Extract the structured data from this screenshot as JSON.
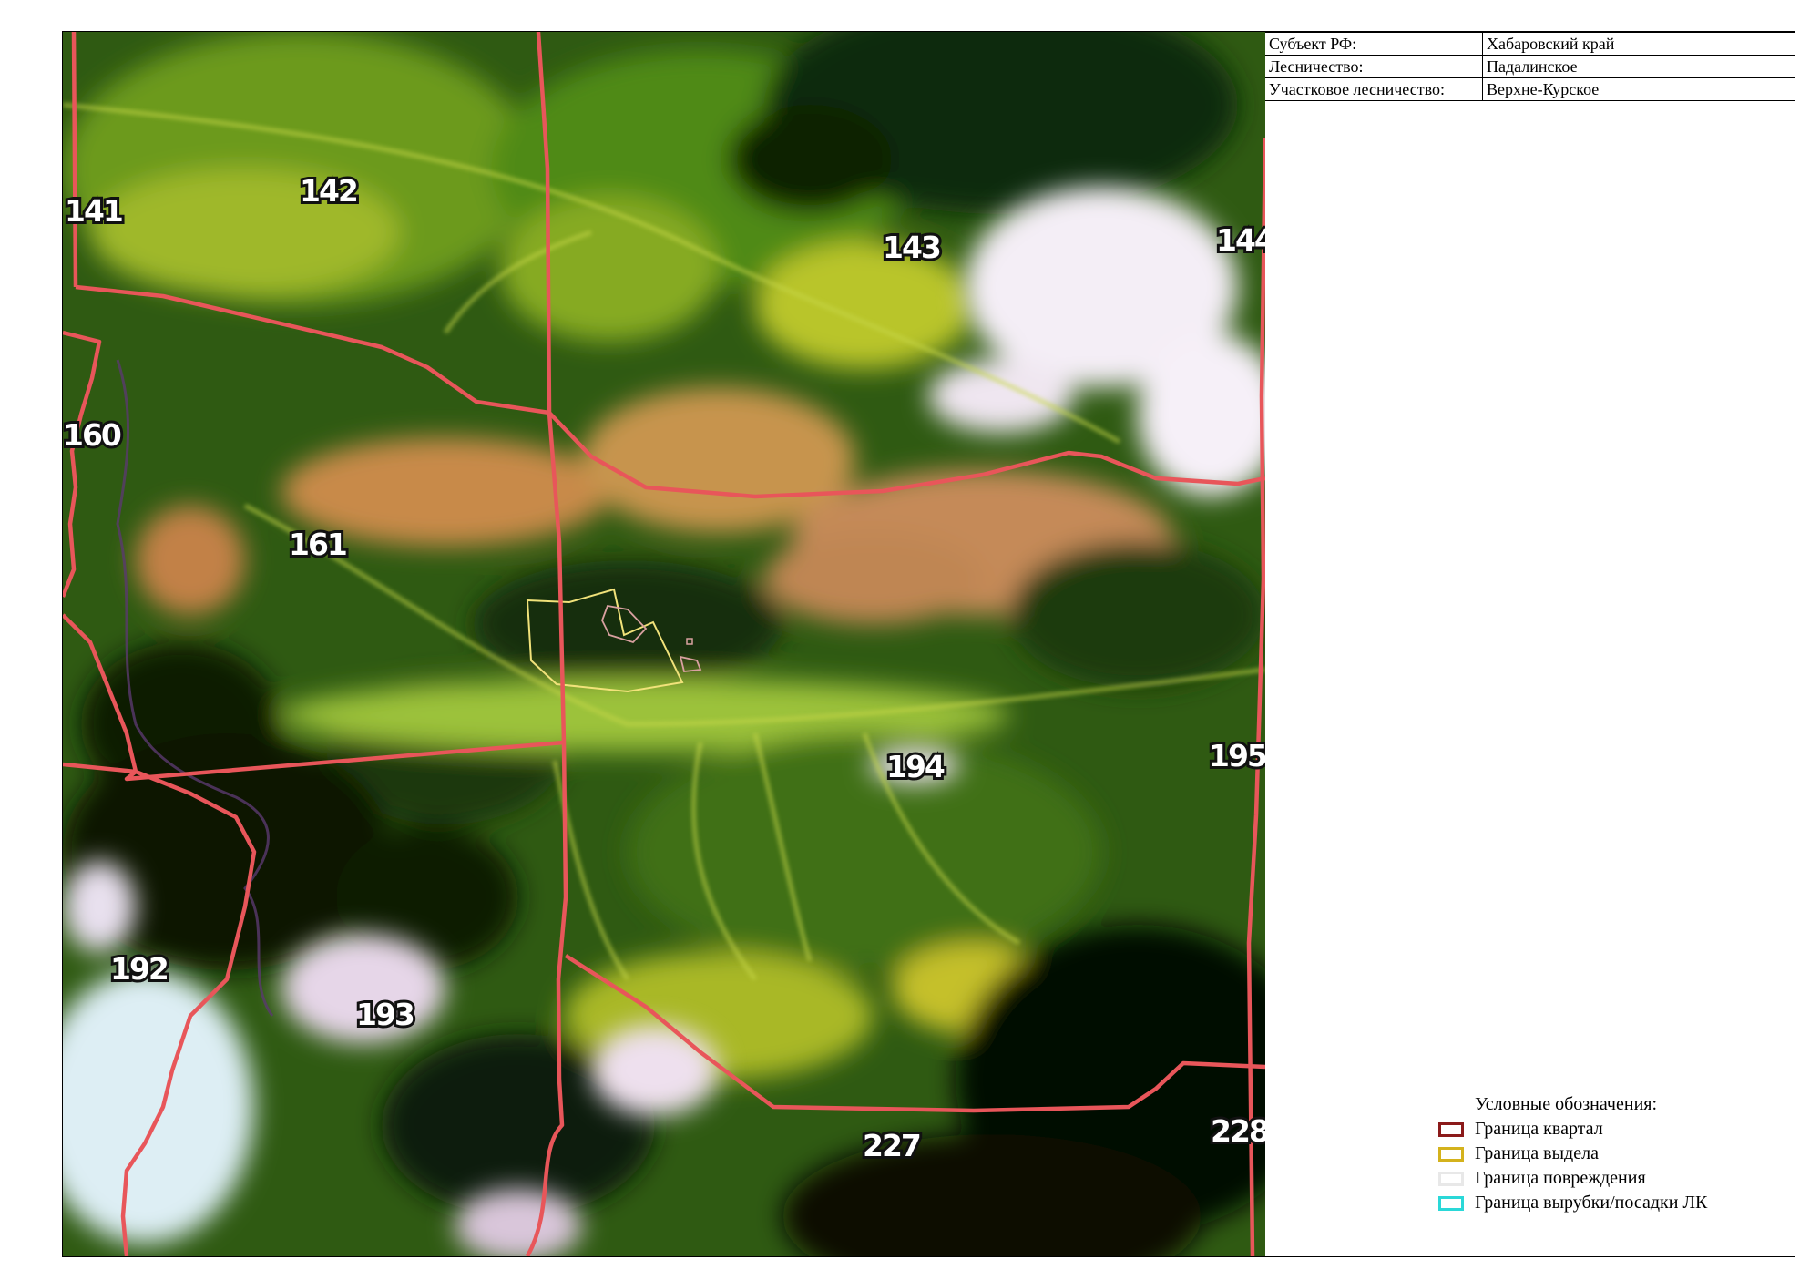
{
  "info": {
    "subject_label": "Субъект РФ:",
    "subject_value": "Хабаровский край",
    "forestry_label": "Лесничество:",
    "forestry_value": "Падалинское",
    "district_label": "Участковое лесничество:",
    "district_value": "Верхне-Курское"
  },
  "legend": {
    "title": "Условные обозначения:",
    "items": [
      {
        "label": "Граница квартал",
        "color": "#8b1a1a"
      },
      {
        "label": "Граница выдела",
        "color": "#d4b21c"
      },
      {
        "label": "Граница повреждения",
        "color": "#e8e8e8"
      },
      {
        "label": "Граница вырубки/посадки ЛК",
        "color": "#2ad8d8"
      }
    ]
  },
  "quarters": [
    "141",
    "142",
    "143",
    "144",
    "160",
    "161",
    "192",
    "193",
    "194",
    "195",
    "227",
    "228"
  ],
  "colors": {
    "quarter_boundary_on_map": "#e8565a",
    "parcel_boundary_on_map": "#f1e27a",
    "damage_boundary_on_map": "#d9a0a0",
    "clouds": "#f4eef6"
  }
}
